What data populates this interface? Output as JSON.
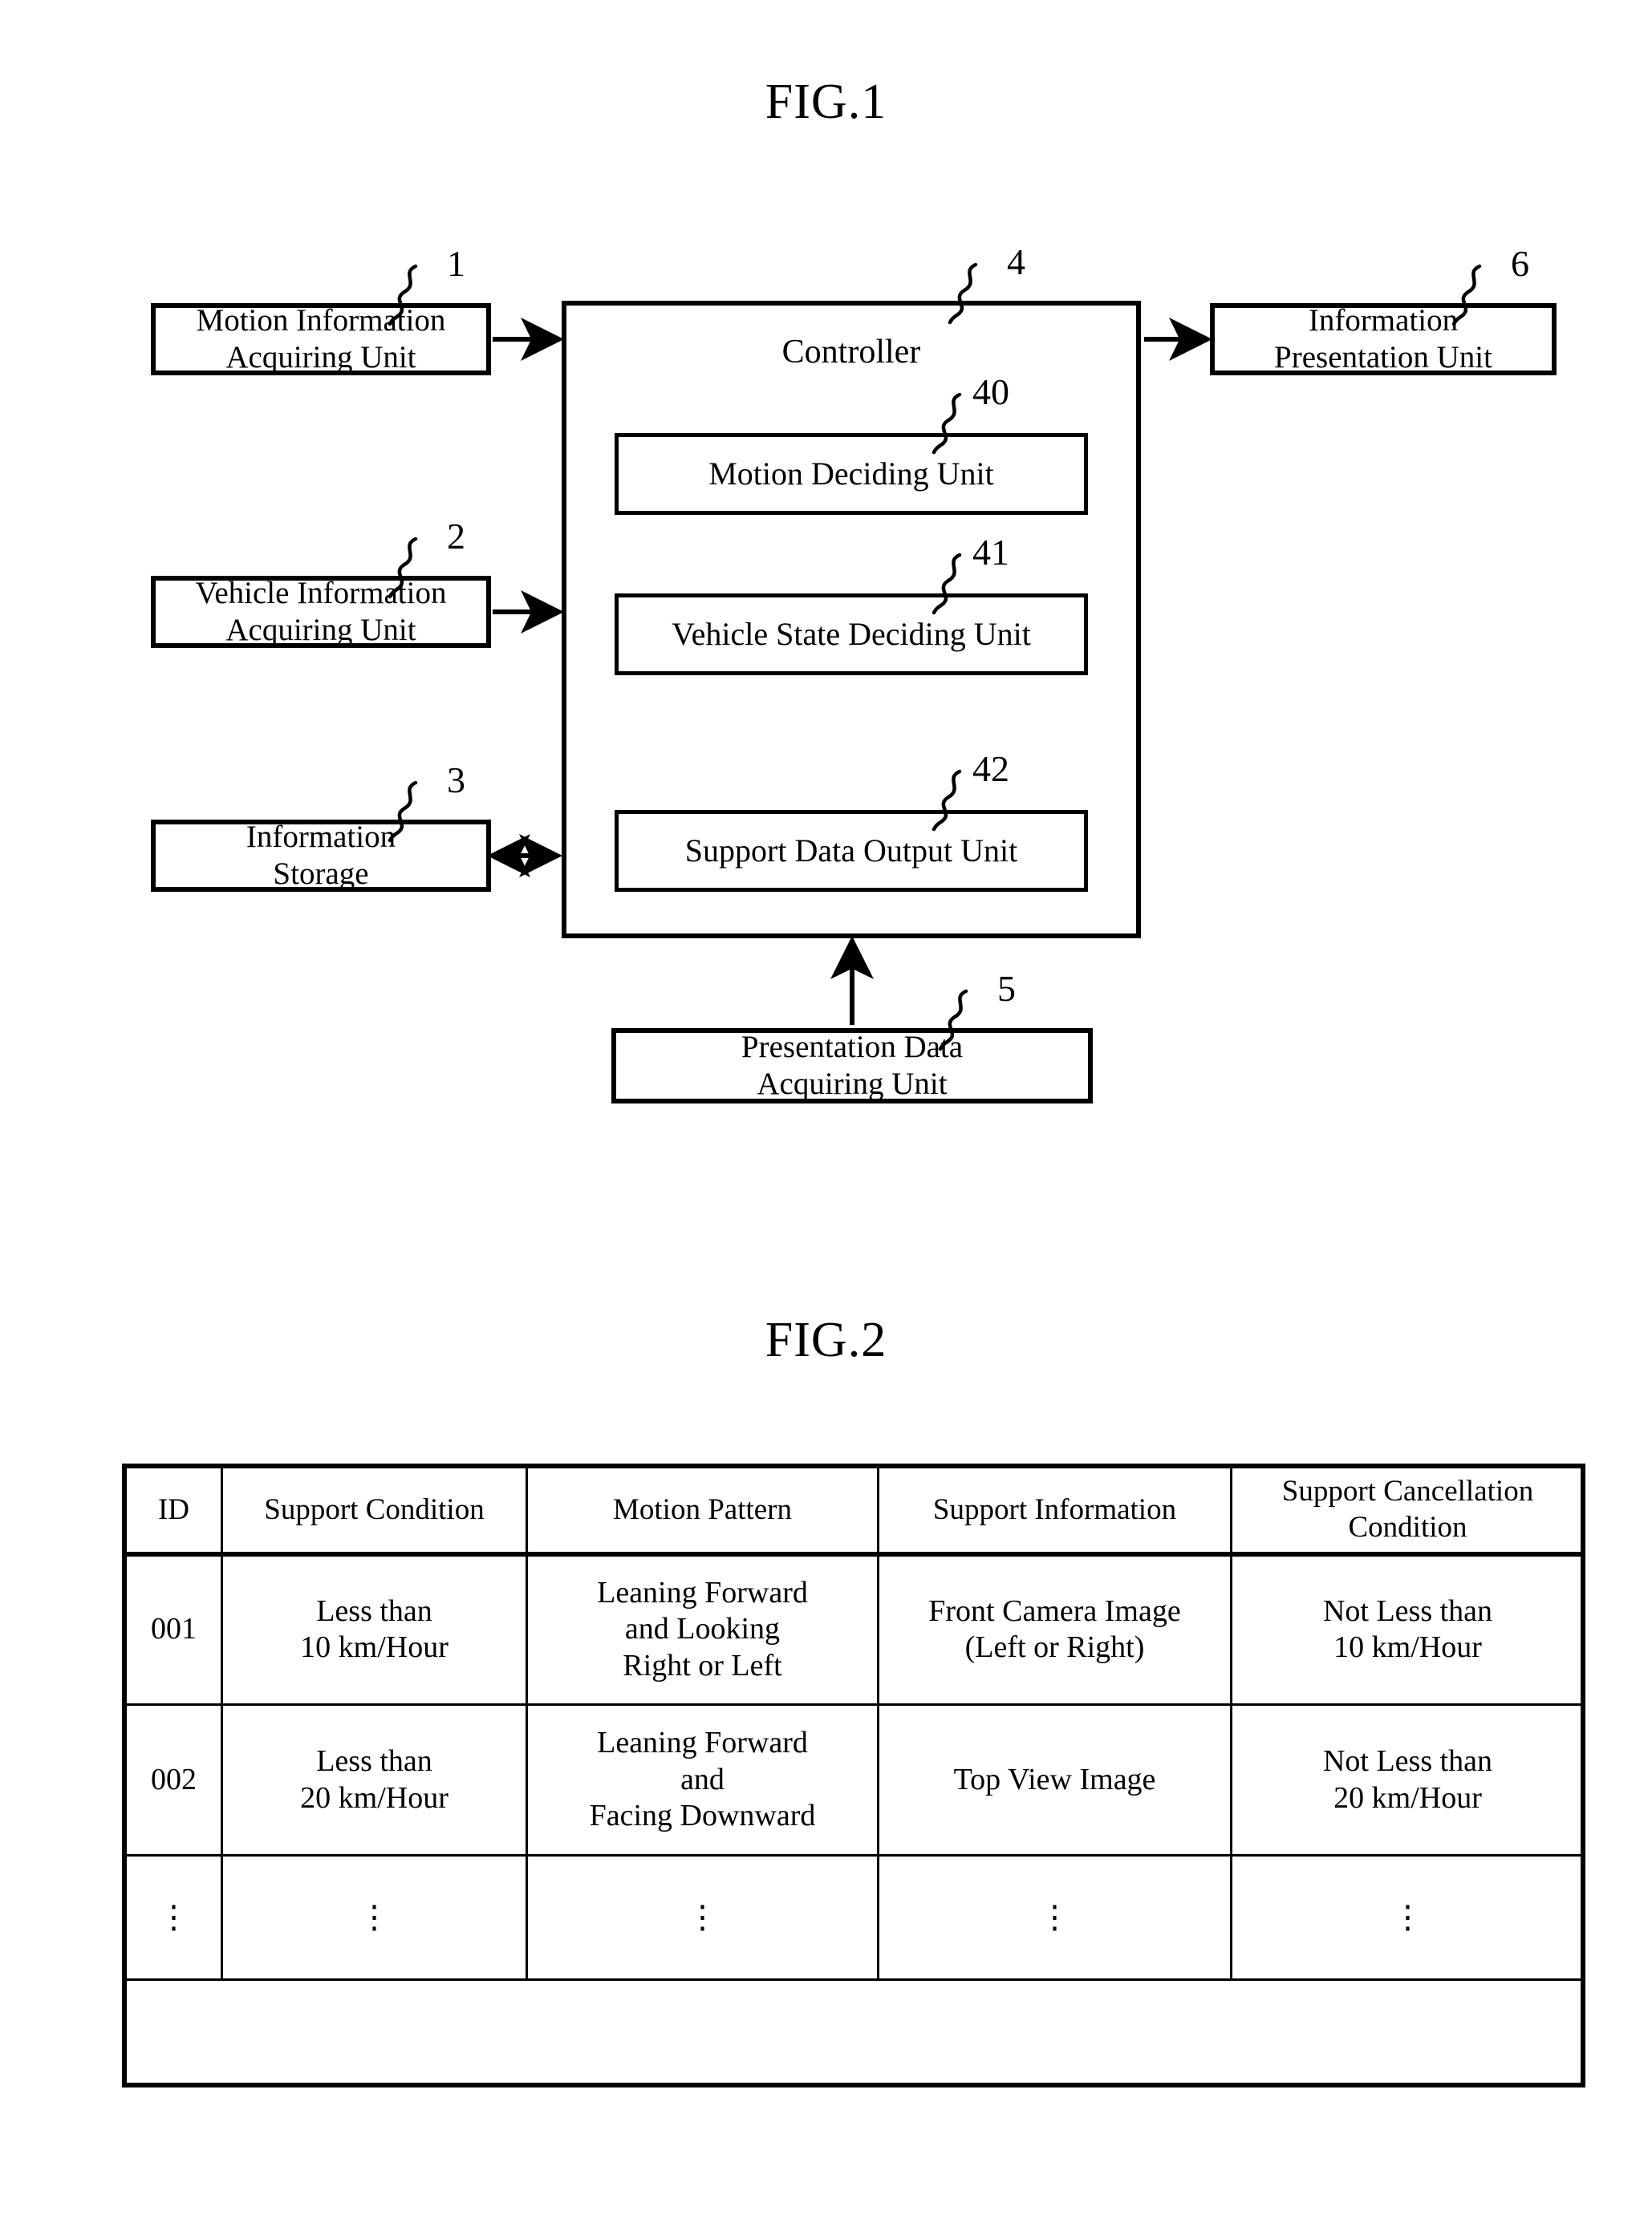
{
  "figures": {
    "fig1": {
      "title": "FIG.1",
      "blocks": {
        "motion_information_acquiring_unit": {
          "line1": "Motion Information",
          "line2": "Acquiring Unit",
          "ref": "1"
        },
        "vehicle_information_acquiring_unit": {
          "line1": "Vehicle Information",
          "line2": "Acquiring Unit",
          "ref": "2"
        },
        "information_storage": {
          "line1": "Information",
          "line2": "Storage",
          "ref": "3"
        },
        "controller": {
          "label": "Controller",
          "ref": "4"
        },
        "motion_deciding_unit": {
          "label": "Motion Deciding Unit",
          "ref": "40"
        },
        "vehicle_state_deciding_unit": {
          "label": "Vehicle State Deciding Unit",
          "ref": "41"
        },
        "support_data_output_unit": {
          "label": "Support Data Output Unit",
          "ref": "42"
        },
        "presentation_data_acquiring_unit": {
          "line1": "Presentation Data",
          "line2": "Acquiring Unit",
          "ref": "5"
        },
        "information_presentation_unit": {
          "line1": "Information",
          "line2": "Presentation Unit",
          "ref": "6"
        }
      },
      "connections": [
        {
          "from": "motion_information_acquiring_unit",
          "to": "controller",
          "type": "single"
        },
        {
          "from": "vehicle_information_acquiring_unit",
          "to": "controller",
          "type": "single"
        },
        {
          "from": "information_storage",
          "to": "controller",
          "type": "double"
        },
        {
          "from": "controller",
          "to": "information_presentation_unit",
          "type": "single"
        },
        {
          "from": "presentation_data_acquiring_unit",
          "to": "controller",
          "type": "single"
        }
      ]
    },
    "fig2": {
      "title": "FIG.2",
      "table": {
        "headers": [
          "ID",
          "Support Condition",
          "Motion Pattern",
          "Support Information",
          "Support Cancellation Condition"
        ],
        "header_lines": {
          "support_cancellation_condition": [
            "Support Cancellation",
            "Condition"
          ]
        },
        "rows": [
          {
            "id": "001",
            "support_condition": [
              "Less than",
              "10 km/Hour"
            ],
            "motion_pattern": [
              "Leaning Forward",
              "and Looking",
              "Right or Left"
            ],
            "support_information": [
              "Front Camera Image",
              "(Left or Right)"
            ],
            "support_cancellation_condition": [
              "Not Less than",
              "10 km/Hour"
            ]
          },
          {
            "id": "002",
            "support_condition": [
              "Less than",
              "20 km/Hour"
            ],
            "motion_pattern": [
              "Leaning Forward",
              "and",
              "Facing Downward"
            ],
            "support_information": [
              "Top View Image"
            ],
            "support_cancellation_condition": [
              "Not Less than",
              "20 km/Hour"
            ]
          },
          {
            "id": "⋮",
            "support_condition": [
              "⋮"
            ],
            "motion_pattern": [
              "⋮"
            ],
            "support_information": [
              "⋮"
            ],
            "support_cancellation_condition": [
              "⋮"
            ]
          }
        ]
      }
    }
  },
  "colors": {
    "ink": "#000000",
    "paper": "#ffffff"
  }
}
